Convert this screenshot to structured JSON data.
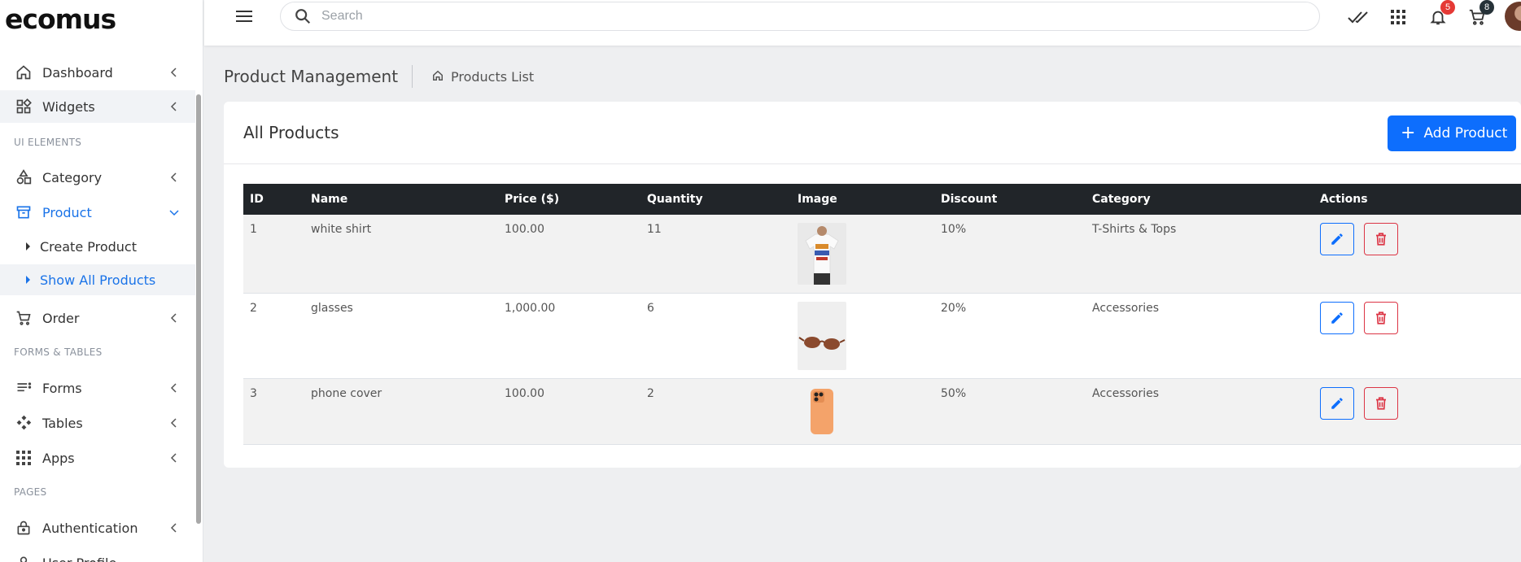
{
  "brand": {
    "logo_text": "ecomus"
  },
  "sidebar": {
    "items": [
      {
        "label": "Dashboard",
        "icon": "home-icon"
      },
      {
        "label": "Widgets",
        "icon": "widgets-icon"
      },
      {
        "label": "Category",
        "icon": "category-icon"
      },
      {
        "label": "Product",
        "icon": "product-box-icon"
      },
      {
        "label": "Order",
        "icon": "cart-icon"
      },
      {
        "label": "Forms",
        "icon": "forms-icon"
      },
      {
        "label": "Tables",
        "icon": "tables-icon"
      },
      {
        "label": "Apps",
        "icon": "apps-grid-icon"
      },
      {
        "label": "Authentication",
        "icon": "lock-icon"
      },
      {
        "label": "User Profile",
        "icon": "user-icon"
      }
    ],
    "sections": {
      "ui_elements": "UI ELEMENTS",
      "forms_tables": "FORMS & TABLES",
      "pages": "PAGES"
    },
    "product_sub": [
      {
        "label": "Create Product"
      },
      {
        "label": "Show All Products"
      }
    ]
  },
  "header": {
    "search_placeholder": "Search",
    "notifications_count": "5",
    "cart_count": "8"
  },
  "breadcrumb": {
    "title": "Product Management",
    "link": "Products List"
  },
  "card": {
    "title": "All Products",
    "add_label": "Add Product"
  },
  "table": {
    "headers": [
      "ID",
      "Name",
      "Price ($)",
      "Quantity",
      "Image",
      "Discount",
      "Category",
      "Actions"
    ],
    "rows": [
      {
        "id": "1",
        "name": "white shirt",
        "price": "100.00",
        "quantity": "11",
        "image": "white-shirt-image",
        "discount": "10%",
        "category": "T-Shirts & Tops"
      },
      {
        "id": "2",
        "name": "glasses",
        "price": "1,000.00",
        "quantity": "6",
        "image": "sunglasses-image",
        "discount": "20%",
        "category": "Accessories"
      },
      {
        "id": "3",
        "name": "phone cover",
        "price": "100.00",
        "quantity": "2",
        "image": "phone-cover-image",
        "discount": "50%",
        "category": "Accessories"
      }
    ]
  },
  "colors": {
    "accent": "#0d6efd",
    "active_nav": "#1a73e8",
    "table_header": "#212529",
    "delete": "#dc3545"
  }
}
